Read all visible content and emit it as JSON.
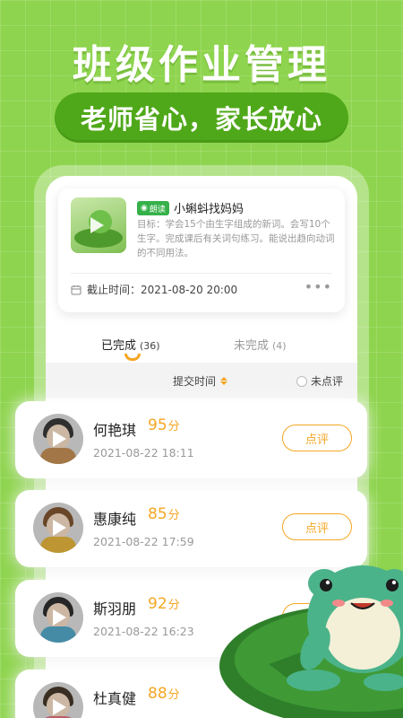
{
  "headline": "班级作业管理",
  "subtitle": "老师省心，家长放心",
  "task": {
    "badge": "朗读",
    "title": "小蝌蚪找妈妈",
    "description": "目标：学会15个由生字组成的新词。会写10个生字。完成课后有关词句练习。能说出趋向动词的不同用法。",
    "deadline_label": "截止时间：",
    "deadline": "2021-08-20 20:00",
    "more": "•••"
  },
  "tabs": {
    "done_label": "已完成",
    "done_count": "(36)",
    "pending_label": "未完成",
    "pending_count": "(4)"
  },
  "filter": {
    "sort_label": "提交时间",
    "unreviewed_label": "未点评"
  },
  "students": [
    {
      "name": "何艳琪",
      "score": "95",
      "unit": "分",
      "time": "2021-08-22 18:11",
      "button": "点评"
    },
    {
      "name": "惠康纯",
      "score": "85",
      "unit": "分",
      "time": "2021-08-22 17:59",
      "button": "点评"
    },
    {
      "name": "斯羽朋",
      "score": "92",
      "unit": "分",
      "time": "2021-08-22 16:23",
      "button": "点评"
    },
    {
      "name": "杜真健",
      "score": "88",
      "unit": "分",
      "time": "",
      "button": ""
    }
  ],
  "colors": {
    "background": "#8ed44e",
    "pill": "#4fa819",
    "accent": "#f5a623",
    "badge": "#36b14a"
  },
  "icons": {
    "calendar": "calendar-icon",
    "play": "play-icon",
    "sort": "sort-icon",
    "more": "more-icon",
    "mascot": "frog-mascot"
  }
}
